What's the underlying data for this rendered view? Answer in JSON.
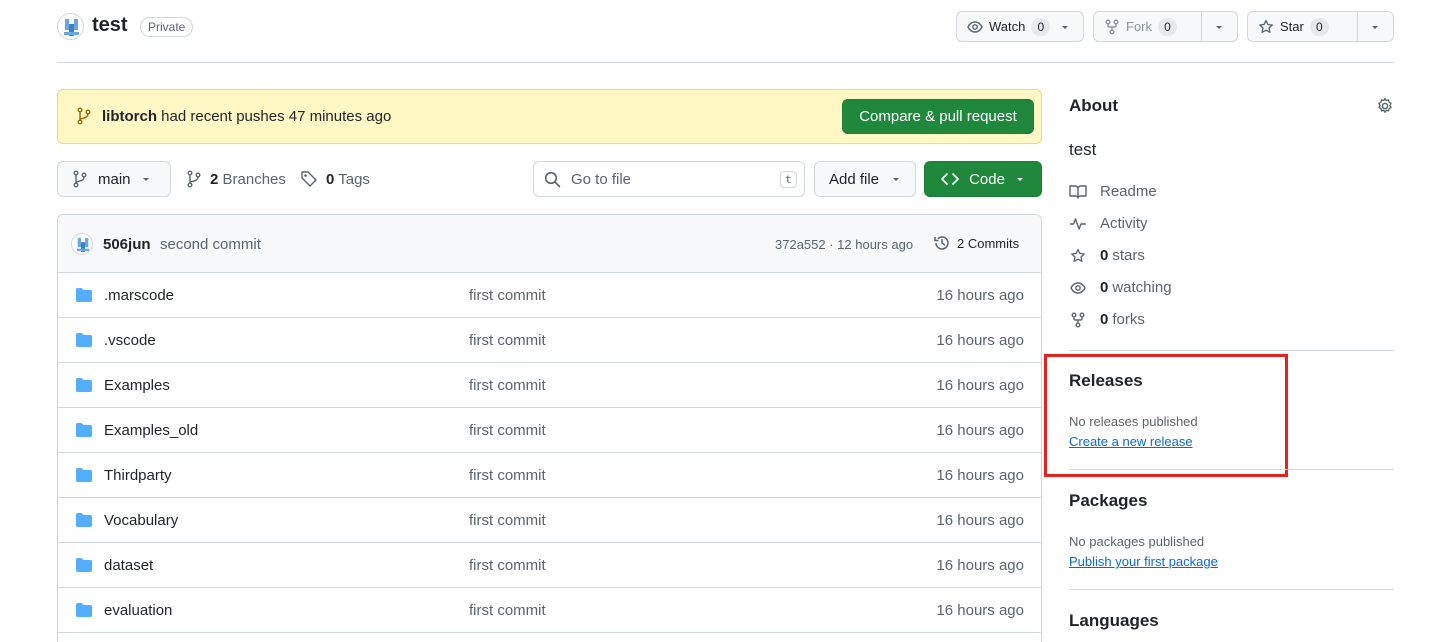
{
  "repo": {
    "name": "test",
    "visibility": "Private"
  },
  "header_actions": {
    "watch": {
      "label": "Watch",
      "count": "0"
    },
    "fork": {
      "label": "Fork",
      "count": "0"
    },
    "star": {
      "label": "Star",
      "count": "0"
    }
  },
  "banner": {
    "branch": "libtorch",
    "text": " had recent pushes 47 minutes ago",
    "button": "Compare & pull request"
  },
  "toolbar": {
    "branch": "main",
    "branches_count": "2",
    "branches_label": "Branches",
    "tags_count": "0",
    "tags_label": "Tags",
    "search_placeholder": "Go to file",
    "search_shortcut": "t",
    "add_file": "Add file",
    "code": "Code"
  },
  "latest_commit": {
    "author": "506jun",
    "message": "second commit",
    "meta": "372a552 · 12 hours ago",
    "commits_label": "2 Commits"
  },
  "files": [
    {
      "name": ".marscode",
      "message": "first commit",
      "age": "16 hours ago"
    },
    {
      "name": ".vscode",
      "message": "first commit",
      "age": "16 hours ago"
    },
    {
      "name": "Examples",
      "message": "first commit",
      "age": "16 hours ago"
    },
    {
      "name": "Examples_old",
      "message": "first commit",
      "age": "16 hours ago"
    },
    {
      "name": "Thirdparty",
      "message": "first commit",
      "age": "16 hours ago"
    },
    {
      "name": "Vocabulary",
      "message": "first commit",
      "age": "16 hours ago"
    },
    {
      "name": "dataset",
      "message": "first commit",
      "age": "16 hours ago"
    },
    {
      "name": "evaluation",
      "message": "first commit",
      "age": "16 hours ago"
    }
  ],
  "about": {
    "title": "About",
    "description": "test",
    "readme": "Readme",
    "activity": "Activity",
    "stars_count": "0",
    "stars_label": "stars",
    "watching_count": "0",
    "watching_label": "watching",
    "forks_count": "0",
    "forks_label": "forks"
  },
  "releases": {
    "title": "Releases",
    "empty": "No releases published",
    "link": "Create a new release"
  },
  "packages": {
    "title": "Packages",
    "empty": "No packages published",
    "link": "Publish your first package"
  },
  "languages": {
    "title": "Languages"
  },
  "colors": {
    "primary_green": "#1f883d",
    "link_blue": "#0969da",
    "folder_blue": "#54aeff",
    "highlight_red": "#e8211d",
    "banner_yellow": "#fff8c5"
  }
}
